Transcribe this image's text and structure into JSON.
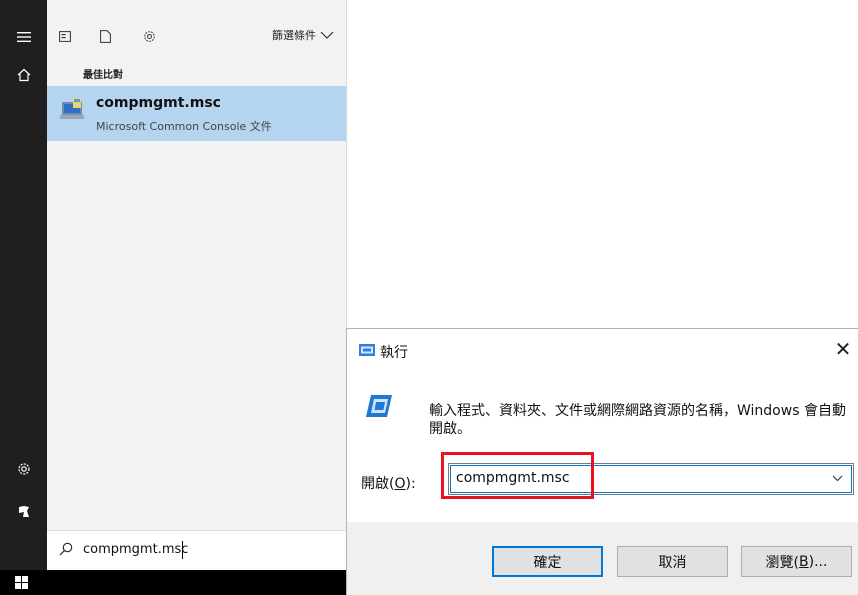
{
  "rail": {
    "icons": [
      "hamburger-icon",
      "home-icon",
      "settings-icon",
      "user-icon"
    ]
  },
  "search_panel": {
    "top_icons": [
      "apps-icon",
      "document-icon",
      "gear-icon"
    ],
    "filter_label": "篩選條件",
    "section_label": "最佳比對",
    "best_match": {
      "title": "compmgmt.msc",
      "subtitle": "Microsoft Common Console 文件"
    },
    "search_box": {
      "icon": "search-icon",
      "value": "compmgmt.msc"
    }
  },
  "run_dialog": {
    "title": "執行",
    "description": "輸入程式、資料夾、文件或網際網路資源的名稱，Windows 會自動開啟。",
    "open_label_prefix": "開啟(",
    "open_label_key": "O",
    "open_label_suffix": "):",
    "open_value": "compmgmt.msc",
    "buttons": {
      "ok": "確定",
      "cancel": "取消",
      "browse_prefix": "瀏覽(",
      "browse_key": "B",
      "browse_suffix": ")..."
    },
    "highlight_color": "#e81123"
  },
  "colors": {
    "accent": "#0078d7",
    "selected_row": "#b5d4ef",
    "rail": "#1f1f1f"
  }
}
